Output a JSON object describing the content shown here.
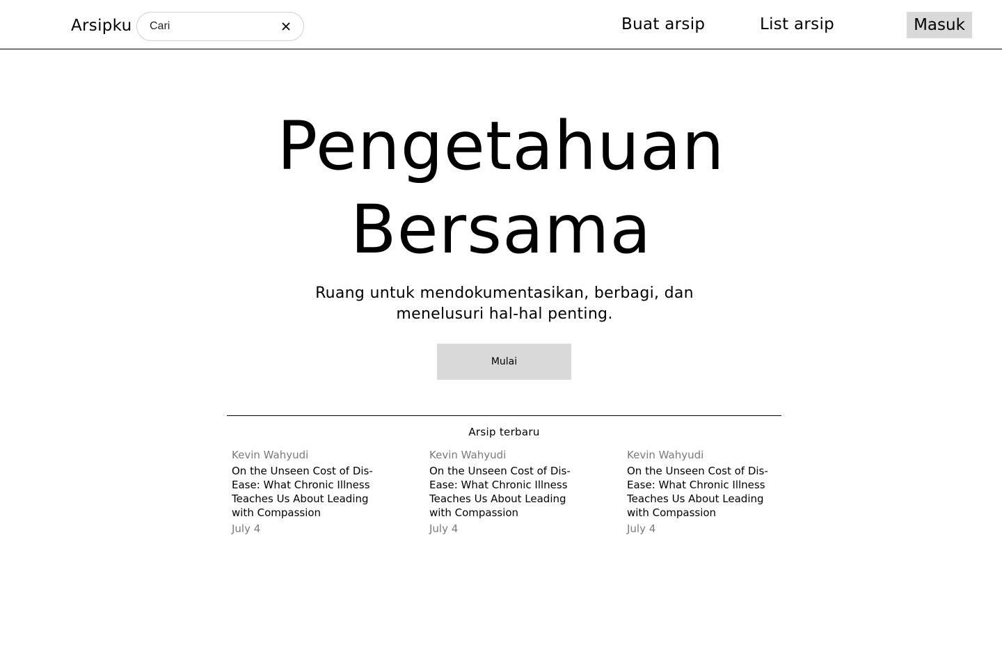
{
  "header": {
    "brand": "Arsipku",
    "search": {
      "placeholder": "Cari",
      "value": ""
    },
    "nav": {
      "create": "Buat arsip",
      "list": "List arsip"
    },
    "login_label": "Masuk"
  },
  "hero": {
    "title": "Pengetahuan Bersama",
    "subtitle": "Ruang untuk mendokumentasikan, berbagi, dan menelusuri hal-hal penting.",
    "cta_label": "Mulai"
  },
  "recent": {
    "heading": "Arsip terbaru",
    "items": [
      {
        "author": "Kevin Wahyudi",
        "title": "On the Unseen Cost of Dis-Ease: What Chronic Illness Teaches Us About Leading with Compassion",
        "date": "July 4"
      },
      {
        "author": "Kevin Wahyudi",
        "title": "On the Unseen Cost of Dis-Ease: What Chronic Illness Teaches Us About Leading with Compassion",
        "date": "July 4"
      },
      {
        "author": "Kevin Wahyudi",
        "title": "On the Unseen Cost of Dis-Ease: What Chronic Illness Teaches Us About Leading with Compassion",
        "date": "July 4"
      }
    ]
  },
  "colors": {
    "button_bg": "#d9d9d9",
    "muted_text": "#7a7a7a",
    "border": "#000000"
  },
  "icons": {
    "clear": "close-icon"
  }
}
